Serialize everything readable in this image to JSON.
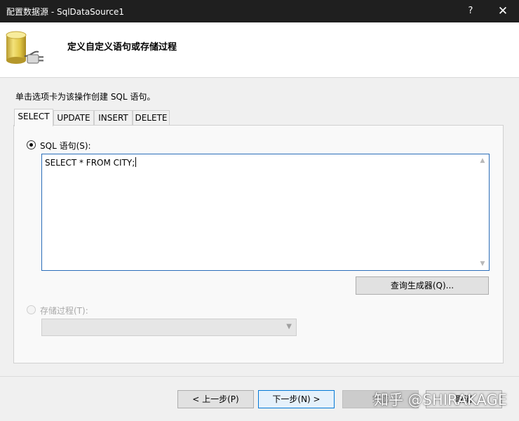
{
  "window": {
    "title": "配置数据源 - SqlDataSource1",
    "help_glyph": "?",
    "close_glyph": "✕"
  },
  "header": {
    "heading": "定义自定义语句或存储过程",
    "icon": "database-connector-icon"
  },
  "instruction": "单击选项卡为该操作创建 SQL 语句。",
  "tabs": [
    {
      "label": "SELECT",
      "active": true
    },
    {
      "label": "UPDATE",
      "active": false
    },
    {
      "label": "INSERT",
      "active": false
    },
    {
      "label": "DELETE",
      "active": false
    }
  ],
  "sql_option": {
    "label": "SQL 语句(S):",
    "selected": true,
    "value": "SELECT * FROM CITY;"
  },
  "query_builder_button": "查询生成器(Q)...",
  "stored_proc_option": {
    "label": "存储过程(T):",
    "selected": false,
    "enabled": false,
    "value": ""
  },
  "footer": {
    "prev_label": "< 上一步(P)",
    "next_label": "下一步(N) >",
    "finish_label": "完成",
    "cancel_label": "取消"
  },
  "watermark": "知乎 @SHIRAKAGE",
  "colors": {
    "titlebar": "#1f1f1f",
    "accent": "#0078d7",
    "sql_box_border": "#2a6db9"
  }
}
